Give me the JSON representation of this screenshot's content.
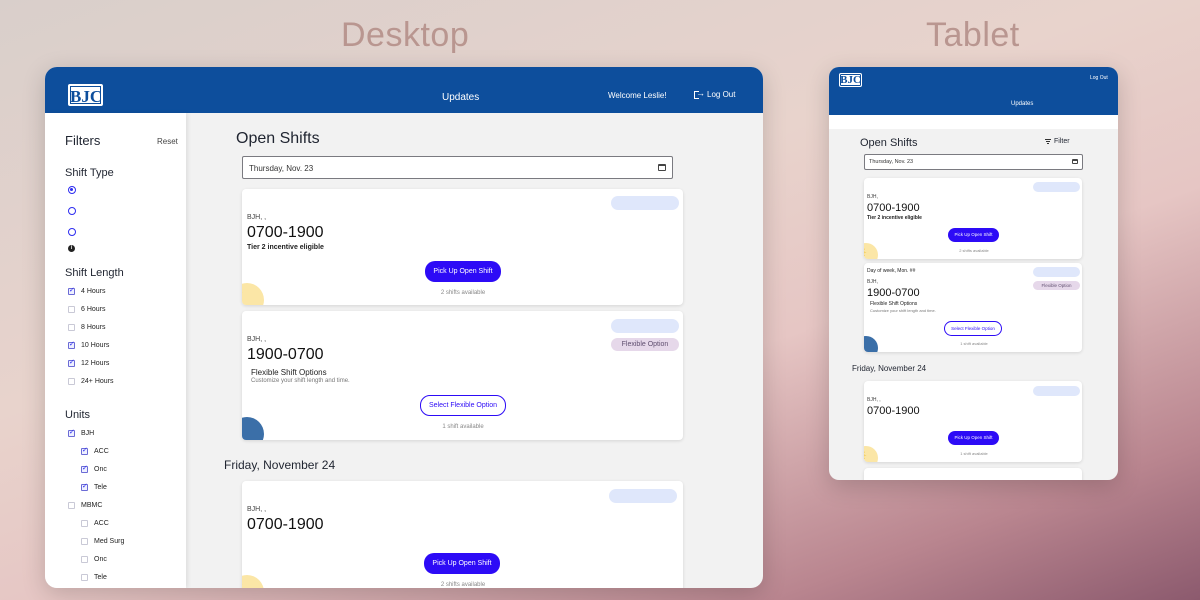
{
  "labels": {
    "desktop": "Desktop",
    "tablet": "Tablet"
  },
  "app": {
    "logo": "BJC",
    "nav_updates": "Updates",
    "welcome": "Welcome Leslie!",
    "logout": "Log Out",
    "logout_tablet": "Log Out"
  },
  "sidebar": {
    "title": "Filters",
    "reset": "Reset",
    "shift_type_heading": "Shift Type",
    "shift_length_heading": "Shift Length",
    "shift_lengths": [
      {
        "label": "4 Hours",
        "checked": true
      },
      {
        "label": "6 Hours",
        "checked": false
      },
      {
        "label": "8 Hours",
        "checked": false
      },
      {
        "label": "10 Hours",
        "checked": true
      },
      {
        "label": "12 Hours",
        "checked": true
      },
      {
        "label": "24+ Hours",
        "checked": false
      }
    ],
    "units_heading": "Units",
    "units": [
      {
        "label": "BJH",
        "checked": true,
        "child": false
      },
      {
        "label": "ACC",
        "checked": true,
        "child": true
      },
      {
        "label": "Onc",
        "checked": true,
        "child": true
      },
      {
        "label": "Tele",
        "checked": true,
        "child": true
      },
      {
        "label": "MBMC",
        "checked": false,
        "child": false
      },
      {
        "label": "ACC",
        "checked": false,
        "child": true
      },
      {
        "label": "Med Surg",
        "checked": false,
        "child": true
      },
      {
        "label": "Onc",
        "checked": false,
        "child": true
      },
      {
        "label": "Tele",
        "checked": false,
        "child": true
      }
    ]
  },
  "main": {
    "title": "Open Shifts",
    "date_value": "Thursday, Nov. 23",
    "cards": [
      {
        "location": "BJH,         ,",
        "time": "0700-1900",
        "subtitle": "Tier 2 incentive eligible",
        "button": "Pick Up Open Shift",
        "availability": "2 shifts available"
      },
      {
        "location": "BJH,         ,",
        "time": "1900-0700",
        "badge": "Flexible Option",
        "subtitle": "Flexible Shift Options",
        "description": "Customize your shift length and time.",
        "button": "Select Flexible Option",
        "availability": "1 shift available"
      }
    ],
    "day2_heading": "Friday, November 24",
    "day2_card": {
      "location": "BJH,         ,",
      "time": "0700-1900",
      "button": "Pick Up Open Shift",
      "availability": "2 shifts available"
    }
  },
  "tablet": {
    "title": "Open Shifts",
    "filter": "Filter",
    "date_value": "Thursday, Nov. 23",
    "card1": {
      "location": "BJH,",
      "time": "0700-1900",
      "subtitle": "Tier 2 incentive eligible",
      "button": "Pick Up Open Shift",
      "availability": "2 shifts available"
    },
    "card2": {
      "day": "Day of week, Mon. ##",
      "location": "BJH,",
      "time": "1900-0700",
      "badge": "Flexible Option",
      "subtitle": "Flexible Shift Options",
      "description": "Customize your shift length and time.",
      "button": "Select Flexible Option",
      "availability": "1 shift available"
    },
    "day2_heading": "Friday, November 24",
    "card3": {
      "location": "BJH,         ,",
      "time": "0700-1900",
      "button": "Pick Up Open Shift",
      "availability": "1 shift available"
    }
  }
}
